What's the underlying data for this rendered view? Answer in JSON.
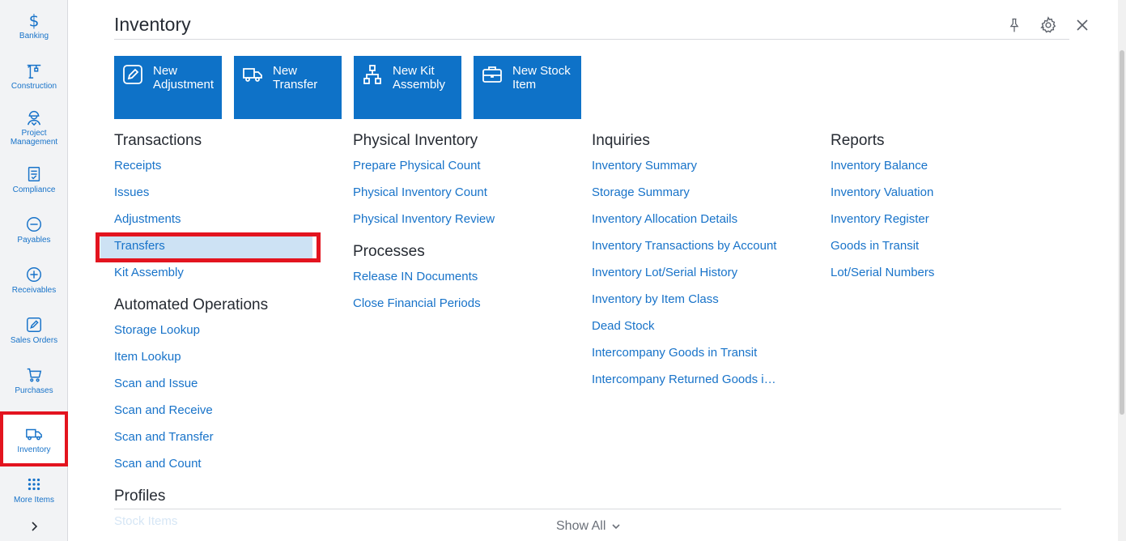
{
  "sidebar": {
    "items": [
      {
        "label": "Banking",
        "icon": "dollar-icon"
      },
      {
        "label": "Construction",
        "icon": "crane-icon"
      },
      {
        "label": "Project\nManagement",
        "icon": "worker-icon"
      },
      {
        "label": "Compliance",
        "icon": "checklist-icon"
      },
      {
        "label": "Payables",
        "icon": "minus-circle-icon"
      },
      {
        "label": "Receivables",
        "icon": "plus-circle-icon"
      },
      {
        "label": "Sales Orders",
        "icon": "edit-icon"
      },
      {
        "label": "Purchases",
        "icon": "cart-icon"
      },
      {
        "label": "Inventory",
        "icon": "truck-icon"
      },
      {
        "label": "More Items",
        "icon": "dots-grid-icon"
      }
    ],
    "expand_glyph": "›"
  },
  "header": {
    "title": "Inventory"
  },
  "tiles": [
    {
      "label": "New Adjustment",
      "line1": "New",
      "line2": "Adjustment",
      "icon": "edit-square-icon"
    },
    {
      "label": "New Transfer",
      "line1": "New",
      "line2": "Transfer",
      "icon": "truck-icon"
    },
    {
      "label": "New Kit Assembly",
      "line1": "New Kit",
      "line2": "Assembly",
      "icon": "hierarchy-icon"
    },
    {
      "label": "New Stock Item",
      "line1": "New Stock",
      "line2": "Item",
      "icon": "briefcase-icon"
    }
  ],
  "columns": [
    {
      "sections": [
        {
          "title": "Transactions",
          "links": [
            "Receipts",
            "Issues",
            "Adjustments",
            "Transfers",
            "Kit Assembly"
          ]
        },
        {
          "title": "Automated Operations",
          "links": [
            "Storage Lookup",
            "Item Lookup",
            "Scan and Issue",
            "Scan and Receive",
            "Scan and Transfer",
            "Scan and Count"
          ]
        },
        {
          "title": "Profiles",
          "links": [
            "Stock Items"
          ]
        }
      ]
    },
    {
      "sections": [
        {
          "title": "Physical Inventory",
          "links": [
            "Prepare Physical Count",
            "Physical Inventory Count",
            "Physical Inventory Review"
          ]
        },
        {
          "title": "Processes",
          "links": [
            "Release IN Documents",
            "Close Financial Periods"
          ]
        }
      ]
    },
    {
      "sections": [
        {
          "title": "Inquiries",
          "links": [
            "Inventory Summary",
            "Storage Summary",
            "Inventory Allocation Details",
            "Inventory Transactions by Account",
            "Inventory Lot/Serial History",
            "Inventory by Item Class",
            "Dead Stock",
            "Intercompany Goods in Transit",
            "Intercompany Returned Goods i…"
          ]
        }
      ]
    },
    {
      "sections": [
        {
          "title": "Reports",
          "links": [
            "Inventory Balance",
            "Inventory Valuation",
            "Inventory Register",
            "Goods in Transit",
            "Lot/Serial Numbers"
          ]
        }
      ]
    }
  ],
  "footer": {
    "show_all": "Show All"
  },
  "colors": {
    "accent": "#0e72c8",
    "link": "#1873c9",
    "highlight": "#e3141f",
    "selected_row": "#cde2f4"
  }
}
